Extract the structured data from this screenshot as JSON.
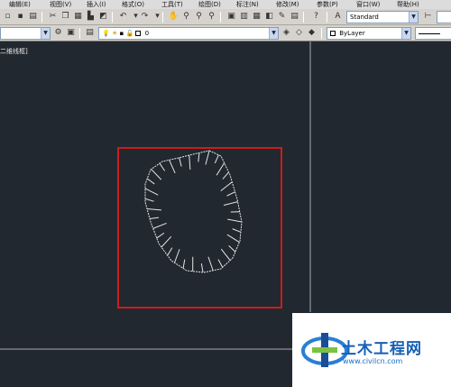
{
  "menu": {
    "items": [
      {
        "label": "编辑(E)"
      },
      {
        "label": "视图(V)"
      },
      {
        "label": "插入(I)"
      },
      {
        "label": "格式(O)"
      },
      {
        "label": "工具(T)"
      },
      {
        "label": "绘图(D)"
      },
      {
        "label": "标注(N)"
      },
      {
        "label": "修改(M)"
      },
      {
        "label": "参数(P)"
      },
      {
        "label": "窗口(W)"
      },
      {
        "label": "帮助(H)"
      }
    ]
  },
  "toolbar": {
    "text_style": "Standard",
    "layer_value": "0",
    "color_value": "ByLayer"
  },
  "viewport": {
    "label": "二维线框]"
  },
  "colors": {
    "canvas": "#212830",
    "highlight": "#cc1c1c",
    "drawing_lines": "#e6e6e6"
  },
  "watermark": {
    "title": "土木工程网",
    "url": "www.civilcn.com"
  }
}
